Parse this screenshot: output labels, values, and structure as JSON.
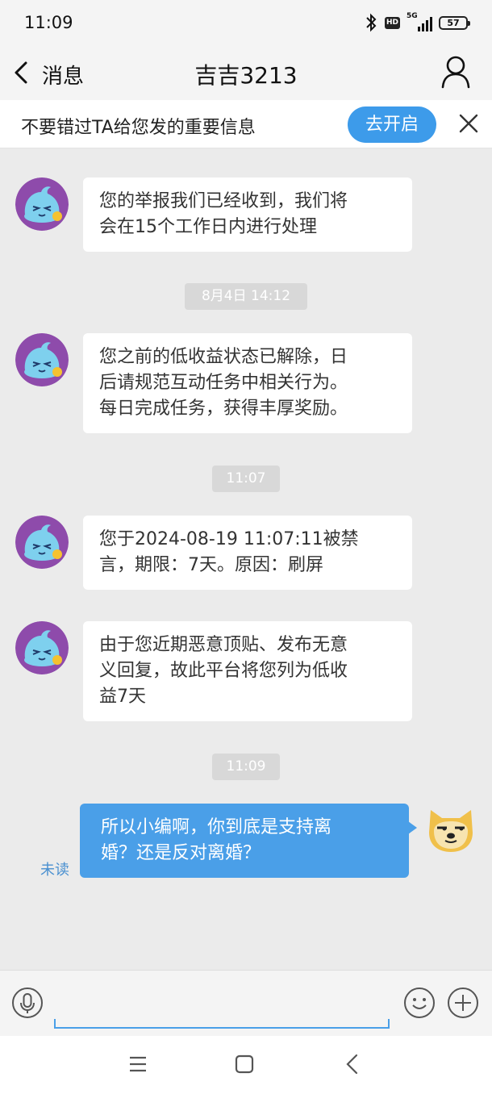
{
  "status_bar": {
    "time": "11:09",
    "network": "5G",
    "hd": "HD",
    "battery": "57"
  },
  "nav": {
    "back_label": "消息",
    "title": "吉吉3213"
  },
  "notice": {
    "text": "不要错过TA给您发的重要信息",
    "button": "去开启"
  },
  "messages": [
    {
      "line1": "您的举报我们已经收到，我们将",
      "line2": "会在15个工作日内进行处理"
    },
    {
      "line1": "您之前的低收益状态已解除，日",
      "line2": "后请规范互动任务中相关行为。",
      "line3": "每日完成任务，获得丰厚奖励。"
    },
    {
      "line1": "您于2024-08-19 11:07:11被禁",
      "line2": "言，期限：7天。原因：刷屏"
    },
    {
      "line1": "由于您近期恶意顶贴、发布无意",
      "line2": "义回复，故此平台将您列为低收",
      "line3": "益7天"
    }
  ],
  "timestamps": {
    "t1": "8月4日 14:12",
    "t2": "11:07",
    "t3": "11:09"
  },
  "self_message": {
    "line1": "所以小编啊，你到底是支持离",
    "line2": "婚？还是反对离婚？",
    "status": "未读"
  },
  "input": {
    "placeholder": ""
  },
  "colors": {
    "accent": "#4a9fe8",
    "button": "#3d9bea",
    "background": "#ebebeb"
  }
}
